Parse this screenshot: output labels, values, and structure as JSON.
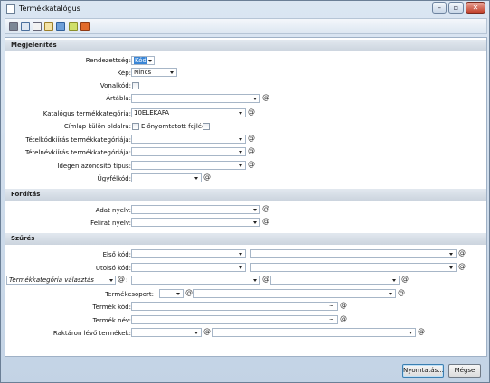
{
  "window": {
    "title": "Termékkatalógus",
    "min_icon": "minimize-icon",
    "max_icon": "maximize-icon",
    "close_icon": "close-icon"
  },
  "toolbar": {
    "icons": [
      "print-icon",
      "preview-icon",
      "copy-icon",
      "edit-icon",
      "table-icon",
      "database-icon",
      "export-icon"
    ]
  },
  "sections": {
    "display": "Megjelenítés",
    "translation": "Fordítás",
    "filter": "Szűrés"
  },
  "display": {
    "order_label": "Rendezettség:",
    "order_value": "Kód",
    "image_label": "Kép:",
    "image_value": "Nincs",
    "barcode_label": "Vonalkód:",
    "pricelist_label": "Ártábla:",
    "pricelist_value": "",
    "category_label": "Katalógus termékkategória:",
    "category_value": "10ELEKAFA",
    "cover_label": "Címlap külön oldalra:",
    "header_label": "Előnyomtatott fejléc:",
    "item_code_cat_label": "Tételkódkiírás termékkategóriája:",
    "item_code_cat_value": "",
    "item_name_cat_label": "Tételnévkiírás termékkategóriája:",
    "item_name_cat_value": "",
    "foreign_id_label": "Idegen azonosító típus:",
    "foreign_id_value": "",
    "client_label": "Ügyfélkód:",
    "client_value": ""
  },
  "translation": {
    "data_lang_label": "Adat nyelv:",
    "data_lang_value": "",
    "caption_lang_label": "Felirat nyelv:",
    "caption_lang_value": ""
  },
  "filter": {
    "first_code_label": "Első kód:",
    "last_code_label": "Utolsó kód:",
    "category_choice_value": "Termékkategória választás",
    "category_colon": ":",
    "group_label": "Termékcsoport:",
    "product_code_label": "Termék kód:",
    "product_name_label": "Termék név:",
    "stock_label": "Raktáron lévő termékek:",
    "dots": "···"
  },
  "buttons": {
    "print": "Nyomtatás...",
    "cancel": "Mégse"
  },
  "link_glyph": "@"
}
